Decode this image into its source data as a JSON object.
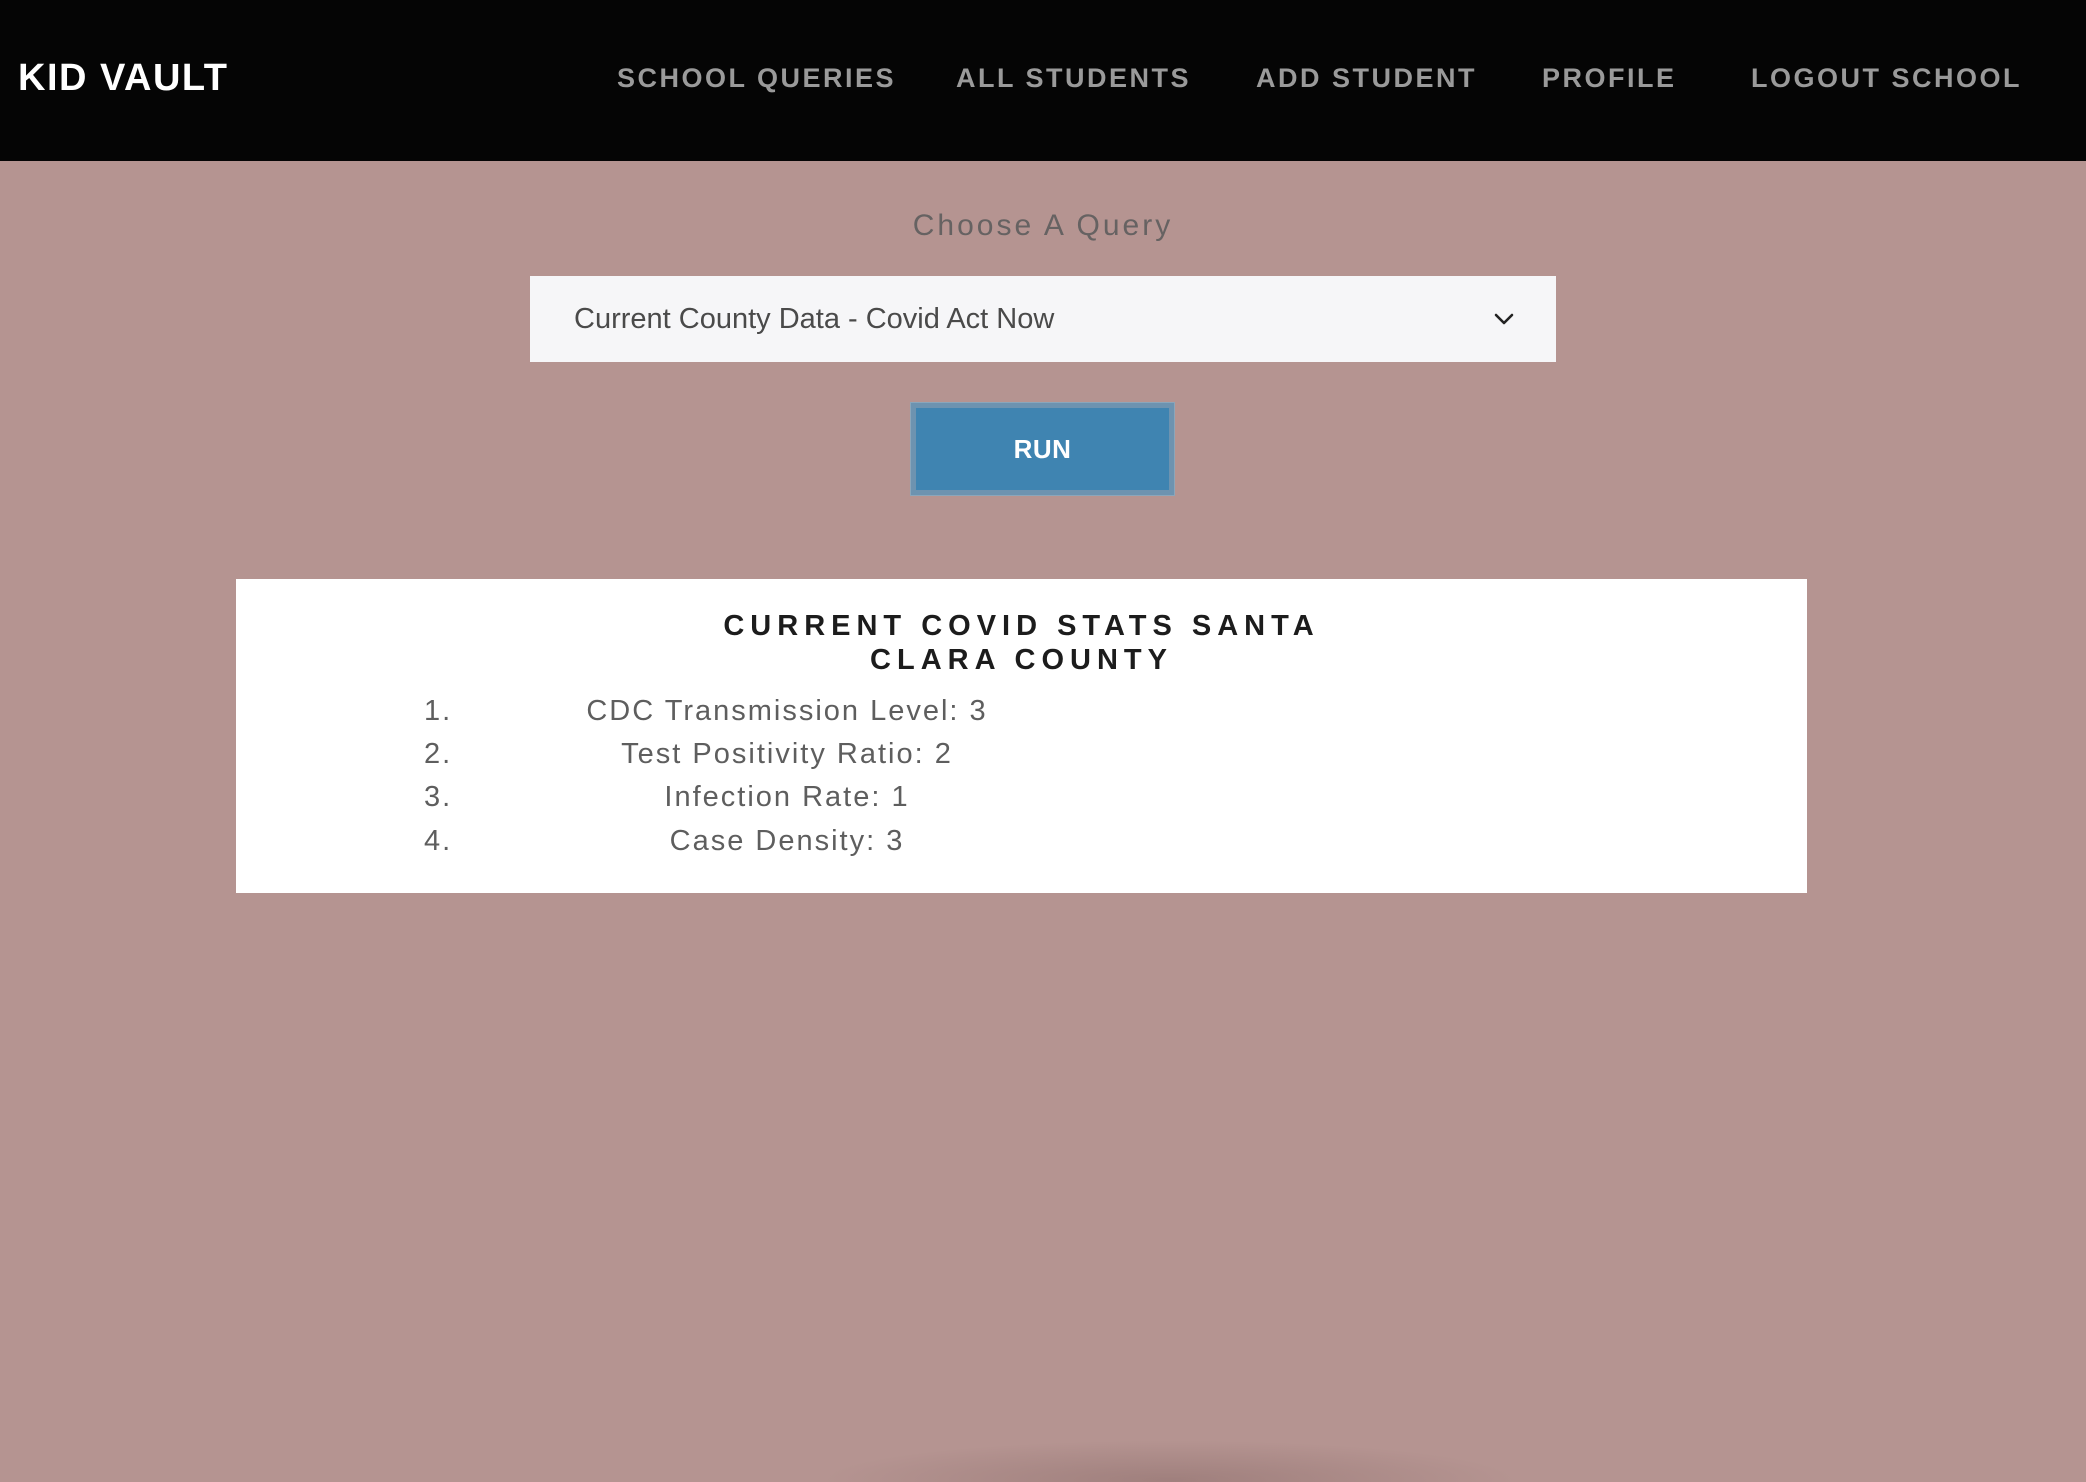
{
  "header": {
    "brand": "KID VAULT",
    "nav": {
      "school_queries": "SCHOOL QUERIES",
      "all_students": "ALL STUDENTS",
      "add_student": "ADD STUDENT",
      "profile": "PROFILE",
      "logout": "LOGOUT SCHOOL"
    }
  },
  "query": {
    "label": "Choose A Query",
    "selected": "Current County Data - Covid Act Now",
    "run_label": "RUN"
  },
  "results": {
    "title": "CURRENT COVID STATS SANTA CLARA COUNTY",
    "items": [
      {
        "num": "1.",
        "text": "CDC Transmission Level: 3"
      },
      {
        "num": "2.",
        "text": "Test Positivity Ratio: 2"
      },
      {
        "num": "3.",
        "text": "Infection Rate: 1"
      },
      {
        "num": "4.",
        "text": "Case Density: 3"
      }
    ]
  },
  "colors": {
    "background": "#b59491",
    "navbar": "#050505",
    "run_button": "#3f84b1"
  },
  "icons": {
    "select_chevron": "chevron-down-icon"
  }
}
